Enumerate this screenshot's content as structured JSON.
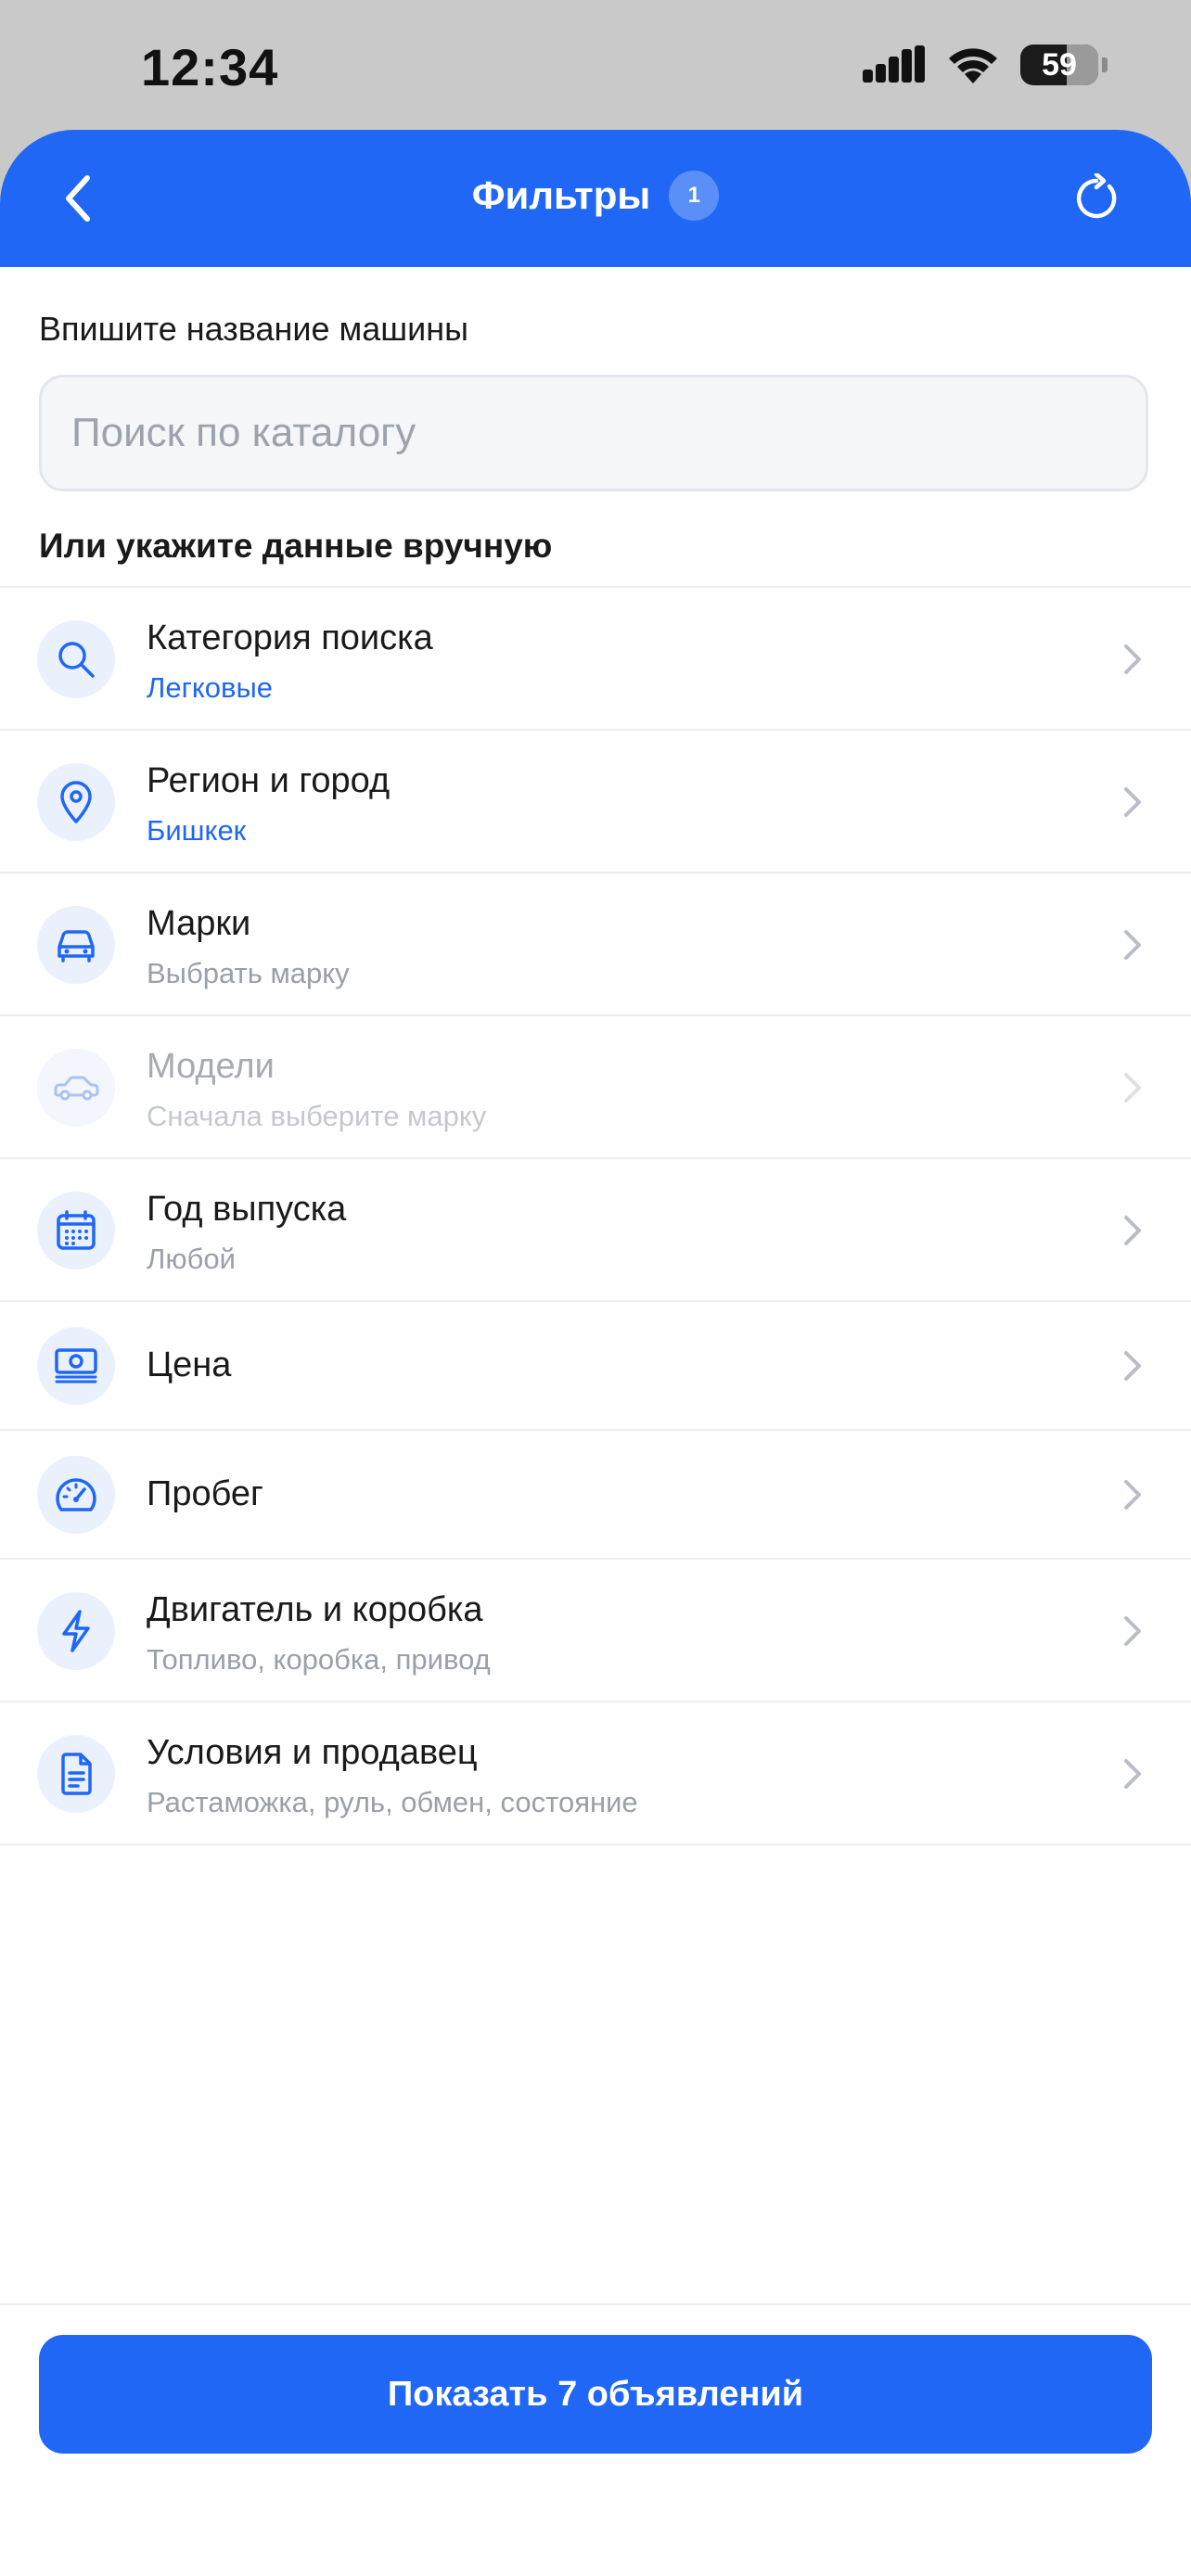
{
  "status_bar": {
    "time": "12:34",
    "battery": "59"
  },
  "header": {
    "title": "Фильтры",
    "badge": "1"
  },
  "search": {
    "label": "Впишите название машины",
    "placeholder": "Поиск по каталогу"
  },
  "manual_label": "Или укажите данные вручную",
  "filters": [
    {
      "icon": "search-icon",
      "title": "Категория поиска",
      "value": "Легковые"
    },
    {
      "icon": "location-pin-icon",
      "title": "Регион и город",
      "value": "Бишкек"
    },
    {
      "icon": "car-icon",
      "title": "Марки",
      "value": "Выбрать марку"
    },
    {
      "icon": "car-icon",
      "title": "Модели",
      "value": "Сначала выберите марку"
    },
    {
      "icon": "calendar-icon",
      "title": "Год выпуска",
      "value": "Любой"
    },
    {
      "icon": "banknote-icon",
      "title": "Цена"
    },
    {
      "icon": "speedometer-icon",
      "title": "Пробег"
    },
    {
      "icon": "lightning-icon",
      "title": "Двигатель и коробка",
      "value": "Топливо, коробка, привод"
    },
    {
      "icon": "document-icon",
      "title": "Условия и продавец",
      "value": "Растаможка, руль, обмен, состояние"
    }
  ],
  "cta": {
    "label": "Показать 7 объявлений"
  },
  "colors": {
    "accent": "#1f67f4",
    "icon_bg": "#eaf1fd"
  }
}
